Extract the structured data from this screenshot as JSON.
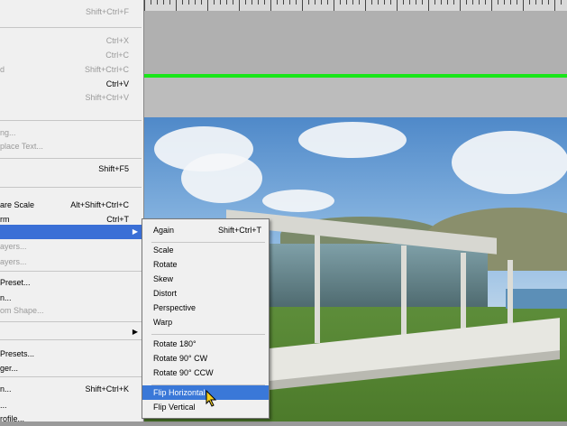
{
  "edit_menu": {
    "items": [
      {
        "label": "",
        "shortcut": "Shift+Ctrl+F",
        "enabled": false
      },
      {
        "label": "",
        "shortcut": "Ctrl+X",
        "enabled": false
      },
      {
        "label": "",
        "shortcut": "Ctrl+C",
        "enabled": false
      },
      {
        "label": "d",
        "shortcut": "Shift+Ctrl+C",
        "enabled": false
      },
      {
        "label": "",
        "shortcut": "Ctrl+V",
        "enabled": true
      },
      {
        "label": "",
        "shortcut": "Shift+Ctrl+V",
        "enabled": false
      },
      {
        "label": "ng...",
        "shortcut": "",
        "enabled": false
      },
      {
        "label": "place Text...",
        "shortcut": "",
        "enabled": false
      },
      {
        "label": "",
        "shortcut": "Shift+F5",
        "enabled": true
      },
      {
        "label": "are Scale",
        "shortcut": "Alt+Shift+Ctrl+C",
        "enabled": true
      },
      {
        "label": "rm",
        "shortcut": "Ctrl+T",
        "enabled": true
      },
      {
        "label": "",
        "shortcut": "",
        "enabled": true,
        "selected": true
      },
      {
        "label": "ayers...",
        "shortcut": "",
        "enabled": false
      },
      {
        "label": "ayers...",
        "shortcut": "",
        "enabled": false
      },
      {
        "label": "Preset...",
        "shortcut": "",
        "enabled": true
      },
      {
        "label": "n...",
        "shortcut": "",
        "enabled": true
      },
      {
        "label": "om Shape...",
        "shortcut": "",
        "enabled": false
      },
      {
        "label": "",
        "shortcut": "",
        "enabled": true
      },
      {
        "label": "Presets...",
        "shortcut": "",
        "enabled": true
      },
      {
        "label": "ger...",
        "shortcut": "",
        "enabled": true
      },
      {
        "label": "n...",
        "shortcut": "Shift+Ctrl+K",
        "enabled": true
      },
      {
        "label": "...",
        "shortcut": "",
        "enabled": true
      },
      {
        "label": "rofile...",
        "shortcut": "",
        "enabled": true
      }
    ]
  },
  "transform_submenu": {
    "items": [
      {
        "label": "Again",
        "shortcut": "Shift+Ctrl+T"
      },
      {
        "label": "Scale",
        "shortcut": ""
      },
      {
        "label": "Rotate",
        "shortcut": ""
      },
      {
        "label": "Skew",
        "shortcut": ""
      },
      {
        "label": "Distort",
        "shortcut": ""
      },
      {
        "label": "Perspective",
        "shortcut": ""
      },
      {
        "label": "Warp",
        "shortcut": ""
      },
      {
        "label": "Rotate 180°",
        "shortcut": ""
      },
      {
        "label": "Rotate 90° CW",
        "shortcut": ""
      },
      {
        "label": "Rotate 90° CCW",
        "shortcut": ""
      },
      {
        "label": "Flip Horizontal",
        "shortcut": "",
        "selected": true
      },
      {
        "label": "Flip Vertical",
        "shortcut": ""
      }
    ]
  },
  "colors": {
    "menu_bg": "#f0f0f0",
    "highlight": "#3a78d8",
    "guide": "#19e619"
  },
  "icons": {
    "submenu_arrow": "chevron-right-icon",
    "cursor": "pointer-cursor-icon"
  }
}
